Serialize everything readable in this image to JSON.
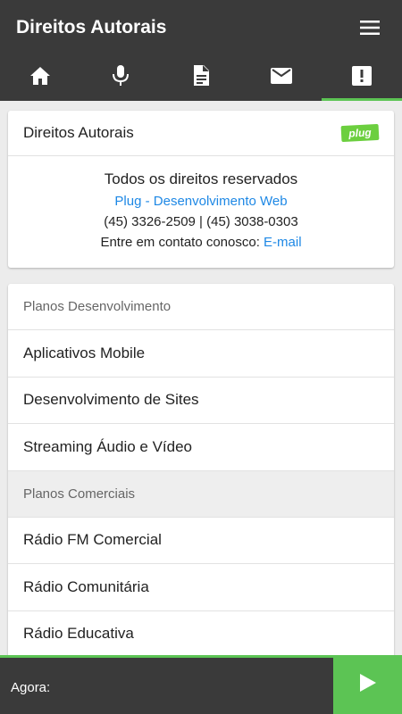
{
  "header": {
    "title": "Direitos Autorais"
  },
  "tabs": [
    {
      "icon": "home-icon",
      "active": false
    },
    {
      "icon": "mic-icon",
      "active": false
    },
    {
      "icon": "document-icon",
      "active": false
    },
    {
      "icon": "mail-icon",
      "active": false
    },
    {
      "icon": "alert-icon",
      "active": true
    }
  ],
  "copyright_card": {
    "title": "Direitos Autorais",
    "logo_text": "plug",
    "rights": "Todos os direitos reservados",
    "company": "Plug - Desenvolvimento Web",
    "phones": "(45) 3326-2509 | (45) 3038-0303",
    "contact_prefix": "Entre em contato conosco:",
    "contact_link": "E-mail"
  },
  "plans": {
    "dev_header": "Planos Desenvolvimento",
    "dev_items": [
      "Aplicativos Mobile",
      "Desenvolvimento de Sites",
      "Streaming Áudio e Vídeo"
    ],
    "commercial_header": "Planos Comerciais",
    "commercial_items": [
      "Rádio FM Comercial",
      "Rádio Comunitária",
      "Rádio Educativa"
    ]
  },
  "player": {
    "now_label": "Agora:"
  },
  "colors": {
    "bar": "#3a3a3a",
    "accent": "#5cc454",
    "link": "#1e88e5"
  }
}
